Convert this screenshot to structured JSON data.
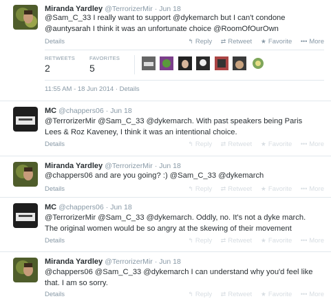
{
  "main": {
    "handle": "@TerrorizerMir",
    "time": "Jun 18",
    "name": "Miranda Yardley",
    "text_parts": [
      "@Sam_C_33",
      " I really want to support ",
      "@dykemarch",
      " but I can't condone ",
      "@auntysarah",
      " I think it was an unfortunate choice ",
      "@RoomOfOurOwn"
    ],
    "details": "Details",
    "actions": {
      "reply": "Reply",
      "retweet": "Retweet",
      "favorite": "Favorite",
      "more": "More"
    },
    "stats": {
      "retweets_label": "RETWEETS",
      "retweets": "2",
      "favorites_label": "FAVORITES",
      "favorites": "5"
    },
    "datetime": "11:55 AM - 18 Jun 2014",
    "datetime_details": "Details"
  },
  "replies": [
    {
      "name": "MC",
      "handle": "@chappers06",
      "time": "Jun 18",
      "line1": "@TerrorizerMir @Sam_C_33 @dykemarch. With past speakers being Paris",
      "line2": "Lees & Roz Kaveney, I think it was an intentional choice.",
      "details": "Details"
    },
    {
      "name": "Miranda Yardley",
      "handle": "@TerrorizerMir",
      "time": "Jun 18",
      "line1": "@chappers06 and are you going? :) @Sam_C_33 @dykemarch",
      "line2": "",
      "details": "Details"
    },
    {
      "name": "MC",
      "handle": "@chappers06",
      "time": "Jun 18",
      "line1": "@TerrorizerMir @Sam_C_33 @dykemarch. Oddly, no. It's not a dyke march.",
      "line2": "The original women would be so angry at the skewing of their movement",
      "details": "Details"
    },
    {
      "name": "Miranda Yardley",
      "handle": "@TerrorizerMir",
      "time": "Jun 18",
      "line1": "@chappers06 @Sam_C_33 @dykemarch I can understand why you'd feel like",
      "line2": "that. I am so sorry.",
      "details": "Details"
    }
  ],
  "colors": {
    "text": "#292f33",
    "muted": "#8899a6",
    "separator": "#e1e8ed"
  },
  "icons": [
    "reply-icon",
    "retweet-icon",
    "favorite-star-icon",
    "more-dots-icon"
  ]
}
